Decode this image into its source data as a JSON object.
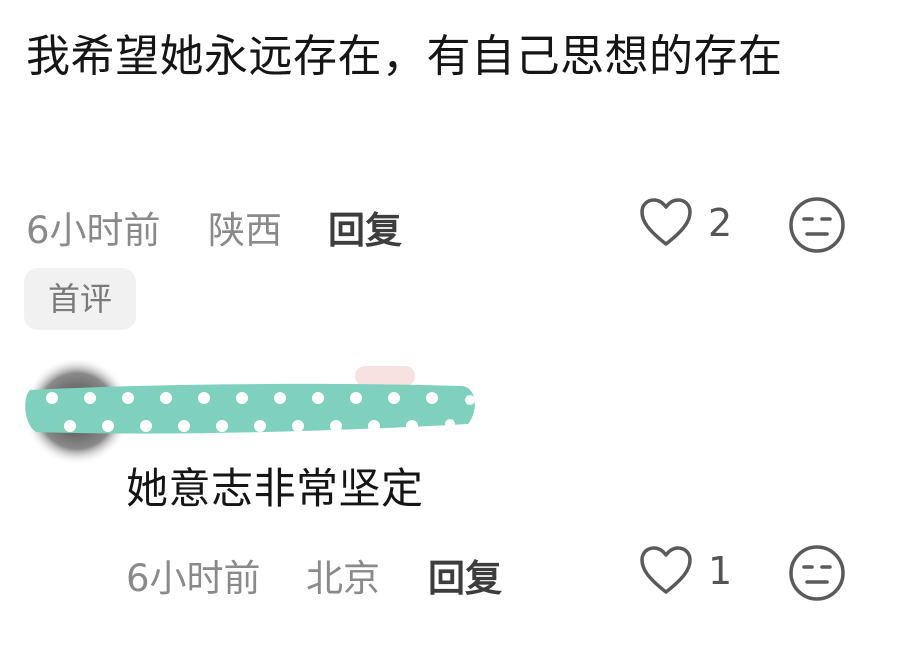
{
  "comment": {
    "text": "我希望她永远存在，有自己思想的存在",
    "time": "6小时前",
    "location": "陕西",
    "reply_label": "回复",
    "like_count": "2",
    "badge": "首评",
    "like_icon": "heart-outline-icon",
    "dislike_icon": "meh-face-icon"
  },
  "reply_comment": {
    "text": "她意志非常坚定",
    "time": "6小时前",
    "location": "北京",
    "reply_label": "回复",
    "like_count": "1",
    "like_icon": "heart-outline-icon",
    "dislike_icon": "meh-face-icon"
  },
  "colors": {
    "censor_mark": "#7fd1bd",
    "text_primary": "#151515",
    "text_secondary": "#8a8a8a"
  }
}
